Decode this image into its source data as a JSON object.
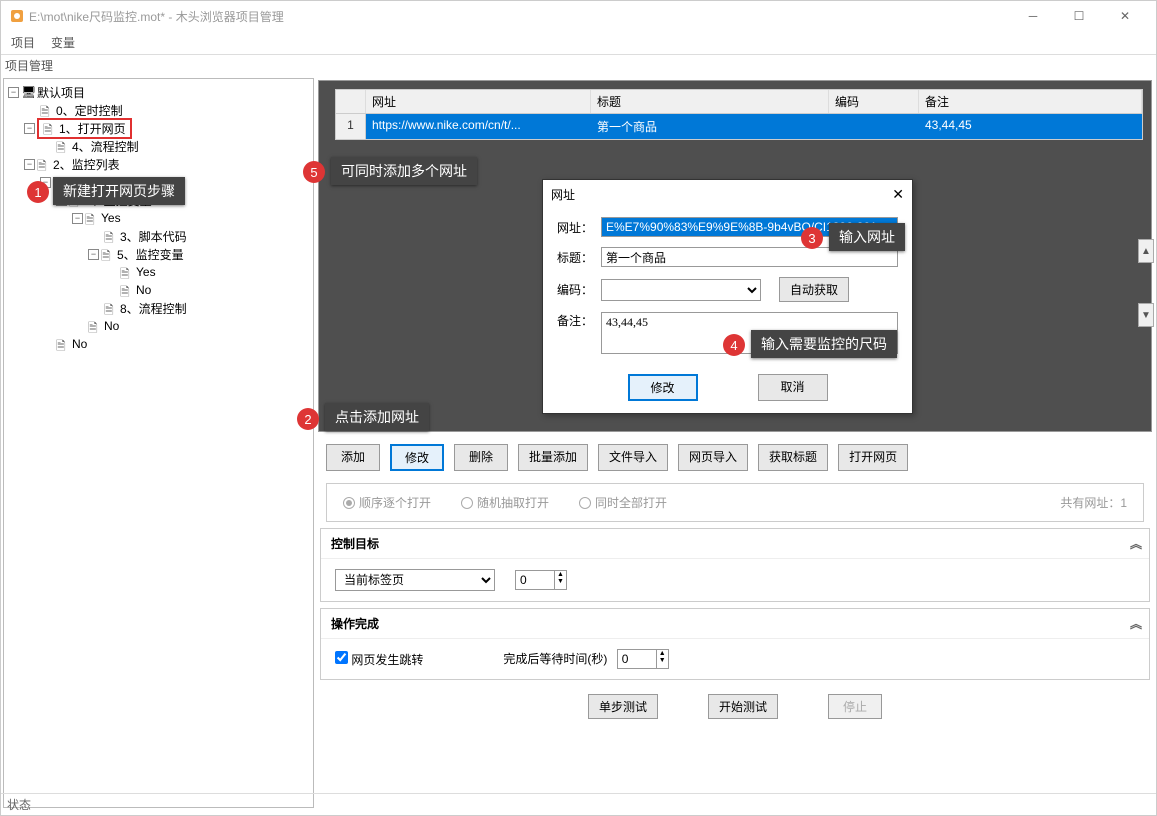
{
  "window": {
    "title": "E:\\mot\\nike尺码监控.mot* - 木头浏览器项目管理"
  },
  "menu": {
    "item1": "项目",
    "item2": "变量"
  },
  "panel_label": "项目管理",
  "tree": {
    "root": "默认项目",
    "n0": "0、定时控制",
    "n1": "1、打开网页",
    "n4": "4、流程控制",
    "n2": "2、监控列表",
    "yes": "Yes",
    "n6": "6、监控变量",
    "n3": "3、脚本代码",
    "n5": "5、监控变量",
    "no": "No",
    "n8": "8、流程控制"
  },
  "table": {
    "h_url": "网址",
    "h_title": "标题",
    "h_enc": "编码",
    "h_note": "备注",
    "row1": {
      "idx": "1",
      "url": "https://www.nike.com/cn/t/...",
      "title": "第一个商品",
      "enc": "",
      "note": "43,44,45"
    }
  },
  "buttons": {
    "add": "添加",
    "edit": "修改",
    "del": "删除",
    "batch": "批量添加",
    "file": "文件导入",
    "web": "网页导入",
    "gettitle": "获取标题",
    "open": "打开网页"
  },
  "radios": {
    "seq": "顺序逐个打开",
    "rand": "随机抽取打开",
    "all": "同时全部打开",
    "count": "共有网址：1"
  },
  "section_target": {
    "title": "控制目标",
    "select": "当前标签页",
    "num": "0"
  },
  "section_done": {
    "title": "操作完成",
    "check": "网页发生跳转",
    "wait_label": "完成后等待时间(秒)",
    "wait_val": "0"
  },
  "bottom": {
    "step": "单步测试",
    "start": "开始测试",
    "stop": "停止"
  },
  "status": "状态",
  "dialog": {
    "title": "网址",
    "l_url": "网址：",
    "v_url": "E%E7%90%83%E9%9E%8B-9b4vBO/CI1396-801",
    "l_title": "标题：",
    "v_title": "第一个商品",
    "l_enc": "编码：",
    "btn_auto": "自动获取",
    "l_note": "备注：",
    "v_note": "43,44,45",
    "ok": "修改",
    "cancel": "取消"
  },
  "callouts": {
    "c1": "新建打开网页步骤",
    "c2": "点击添加网址",
    "c3": "输入网址",
    "c4": "输入需要监控的尺码",
    "c5": "可同时添加多个网址"
  }
}
